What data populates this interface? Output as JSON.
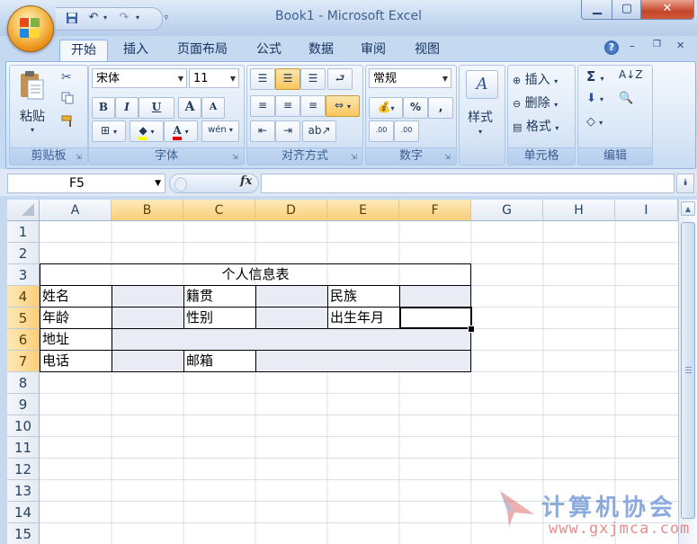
{
  "window": {
    "title": "Book1 - Microsoft Excel"
  },
  "qat": {
    "save_icon": "save-icon",
    "undo_icon": "undo-icon",
    "redo_icon": "redo-icon",
    "customize_icon": "customize-qat-icon"
  },
  "tabs": [
    {
      "label": "开始",
      "active": true
    },
    {
      "label": "插入"
    },
    {
      "label": "页面布局"
    },
    {
      "label": "公式"
    },
    {
      "label": "数据"
    },
    {
      "label": "审阅"
    },
    {
      "label": "视图"
    }
  ],
  "ribbon": {
    "clipboard": {
      "label": "剪贴板",
      "paste": "粘贴"
    },
    "font": {
      "label": "字体",
      "name": "宋体",
      "size": "11",
      "bold": "B",
      "italic": "I",
      "underline": "U",
      "grow": "A",
      "shrink": "A",
      "phonetic": "wén"
    },
    "alignment": {
      "label": "对齐方式"
    },
    "number": {
      "label": "数字",
      "format": "常规",
      "percent": "%",
      "comma": ",",
      "inc_decimal": ".00",
      "dec_decimal": ".00"
    },
    "styles": {
      "label": "样式"
    },
    "cells": {
      "label": "单元格",
      "insert": "插入",
      "delete": "删除",
      "format": "格式"
    },
    "editing": {
      "label": "编辑",
      "sum": "Σ"
    }
  },
  "formula_bar": {
    "name_box": "F5",
    "fx": "fx",
    "value": ""
  },
  "columns": [
    "A",
    "B",
    "C",
    "D",
    "E",
    "F",
    "G",
    "H",
    "I"
  ],
  "rows": [
    "1",
    "2",
    "3",
    "4",
    "5",
    "6",
    "7",
    "8",
    "9",
    "10",
    "11",
    "12",
    "13",
    "14",
    "15"
  ],
  "selected": {
    "column": "F",
    "row": "5"
  },
  "sheet": {
    "title": "个人信息表",
    "r4": {
      "a": "姓名",
      "c": "籍贯",
      "e": "民族"
    },
    "r5": {
      "a": "年龄",
      "c": "性别",
      "e": "出生年月"
    },
    "r6": {
      "a": "地址"
    },
    "r7": {
      "a": "电话",
      "c": "邮箱"
    }
  },
  "watermark": {
    "text": "计算机协会",
    "url": "www.gxjmca.com"
  },
  "colors": {
    "accent": "#f9cf7a",
    "ribbon": "#dde9f7",
    "shade": "#e9ecf5"
  }
}
